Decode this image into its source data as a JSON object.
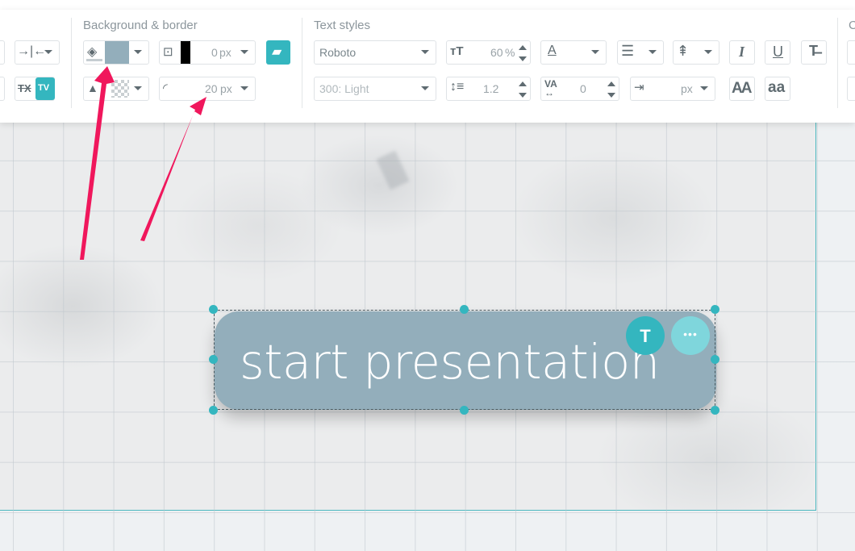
{
  "toolbar": {
    "background_section_title": "Background & border",
    "text_section_title": "Text styles",
    "next_section_title_partial": "C",
    "border_width": "0",
    "border_width_unit": "px",
    "corner_radius": "20",
    "corner_radius_unit": "px",
    "font_family": "Roboto",
    "font_weight": "300: Light",
    "font_size": "60",
    "font_size_unit": "%",
    "line_height": "1.2",
    "letter_spacing": "0",
    "word_spacing_unit": "px",
    "text_color_label": "A",
    "italic_label": "I",
    "underline_label": "U",
    "uppercase_label": "AA",
    "lowercase_label": "aa",
    "tx_label": "TX",
    "tv_label": "TV"
  },
  "canvas": {
    "element_text": "start presentation",
    "type_badge": "T",
    "more_badge": "•••"
  },
  "colors": {
    "accent": "#34b6bf",
    "background_fill": "#93aebb",
    "border_color": "#000000",
    "arrow": "#f0175c"
  },
  "icons": [
    "paint-bucket-icon",
    "border-style-icon",
    "text-effect-icon",
    "image-transparency-icon",
    "corner-radius-icon",
    "font-size-icon",
    "text-color-icon",
    "align-left-icon",
    "line-spacing-icon",
    "italic-icon",
    "underline-icon",
    "strikethrough-icon",
    "line-height-icon",
    "letter-spacing-icon",
    "word-spacing-icon",
    "uppercase-icon",
    "lowercase-icon",
    "spacing-icon",
    "clear-format-icon"
  ]
}
